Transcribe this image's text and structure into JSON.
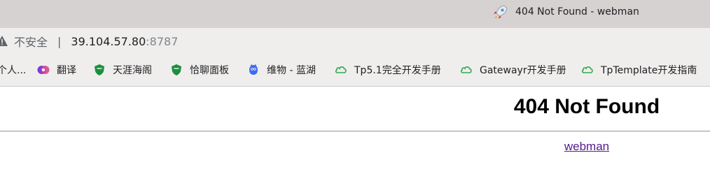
{
  "tab": {
    "title": "404 Not Found - webman",
    "favicon": "rocket-icon"
  },
  "address": {
    "security_label": "不安全",
    "separator": "|",
    "host": "39.104.57.80",
    "port": ":8787"
  },
  "bookmarks": [
    {
      "label": "个人...",
      "icon": "none"
    },
    {
      "label": "翻译",
      "icon": "translate-icon"
    },
    {
      "label": "天涯海阁",
      "icon": "shield-icon"
    },
    {
      "label": "恰聊面板",
      "icon": "shield-icon"
    },
    {
      "label": "维物 - 蓝湖",
      "icon": "lanhu-icon"
    },
    {
      "label": "Tp5.1完全开发手册",
      "icon": "cloud-icon"
    },
    {
      "label": "Gatewayr开发手册",
      "icon": "cloud-icon"
    },
    {
      "label": "TpTemplate开发指南",
      "icon": "cloud-icon"
    }
  ],
  "page": {
    "heading": "404 Not Found",
    "link_text": "webman"
  },
  "colors": {
    "titlebar": "#d6d2d2",
    "toolbar": "#efeeed",
    "link": "#551a8b"
  }
}
